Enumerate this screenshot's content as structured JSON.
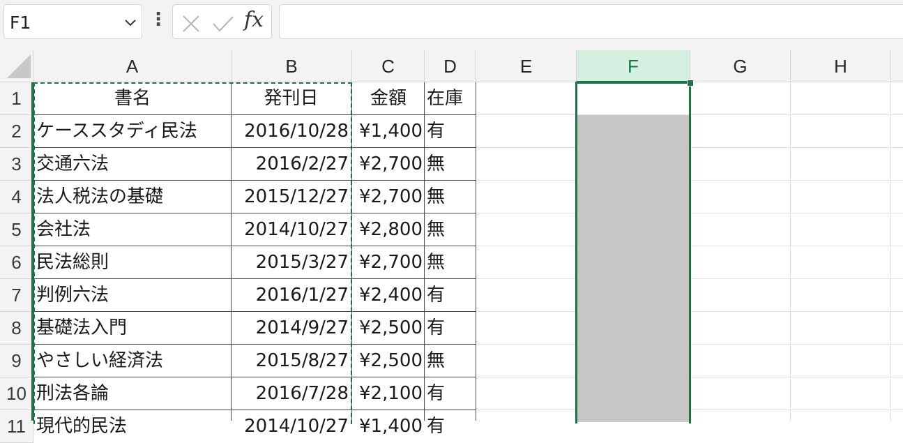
{
  "formula_bar": {
    "name_box": "F1",
    "formula": "",
    "fx_label": "fx",
    "more_symbol": "⋮"
  },
  "columns": [
    "A",
    "B",
    "C",
    "D",
    "E",
    "F",
    "G",
    "H"
  ],
  "selected_column": "F",
  "rows": [
    "1",
    "2",
    "3",
    "4",
    "5",
    "6",
    "7",
    "8",
    "9",
    "10",
    "11"
  ],
  "table": {
    "headers": [
      "書名",
      "発刊日",
      "金額",
      "在庫"
    ],
    "records": [
      [
        "ケーススタディ民法",
        "2016/10/28",
        "¥1,400",
        "有"
      ],
      [
        "交通六法",
        "2016/2/27",
        "¥2,700",
        "無"
      ],
      [
        "法人税法の基礎",
        "2015/12/27",
        "¥2,700",
        "無"
      ],
      [
        "会社法",
        "2014/10/27",
        "¥2,800",
        "無"
      ],
      [
        "民法総則",
        "2015/3/27",
        "¥2,700",
        "無"
      ],
      [
        "判例六法",
        "2016/1/27",
        "¥2,400",
        "有"
      ],
      [
        "基礎法入門",
        "2014/9/27",
        "¥2,500",
        "有"
      ],
      [
        "やさしい経済法",
        "2015/8/27",
        "¥2,500",
        "無"
      ],
      [
        "刑法各論",
        "2016/7/28",
        "¥2,100",
        "有"
      ],
      [
        "現代的民法",
        "2014/10/27",
        "¥1,400",
        "有"
      ]
    ]
  },
  "colors": {
    "accent": "#217346",
    "selected_header_bg": "#d3f0e0",
    "selection_fill": "#c6c6c6"
  }
}
